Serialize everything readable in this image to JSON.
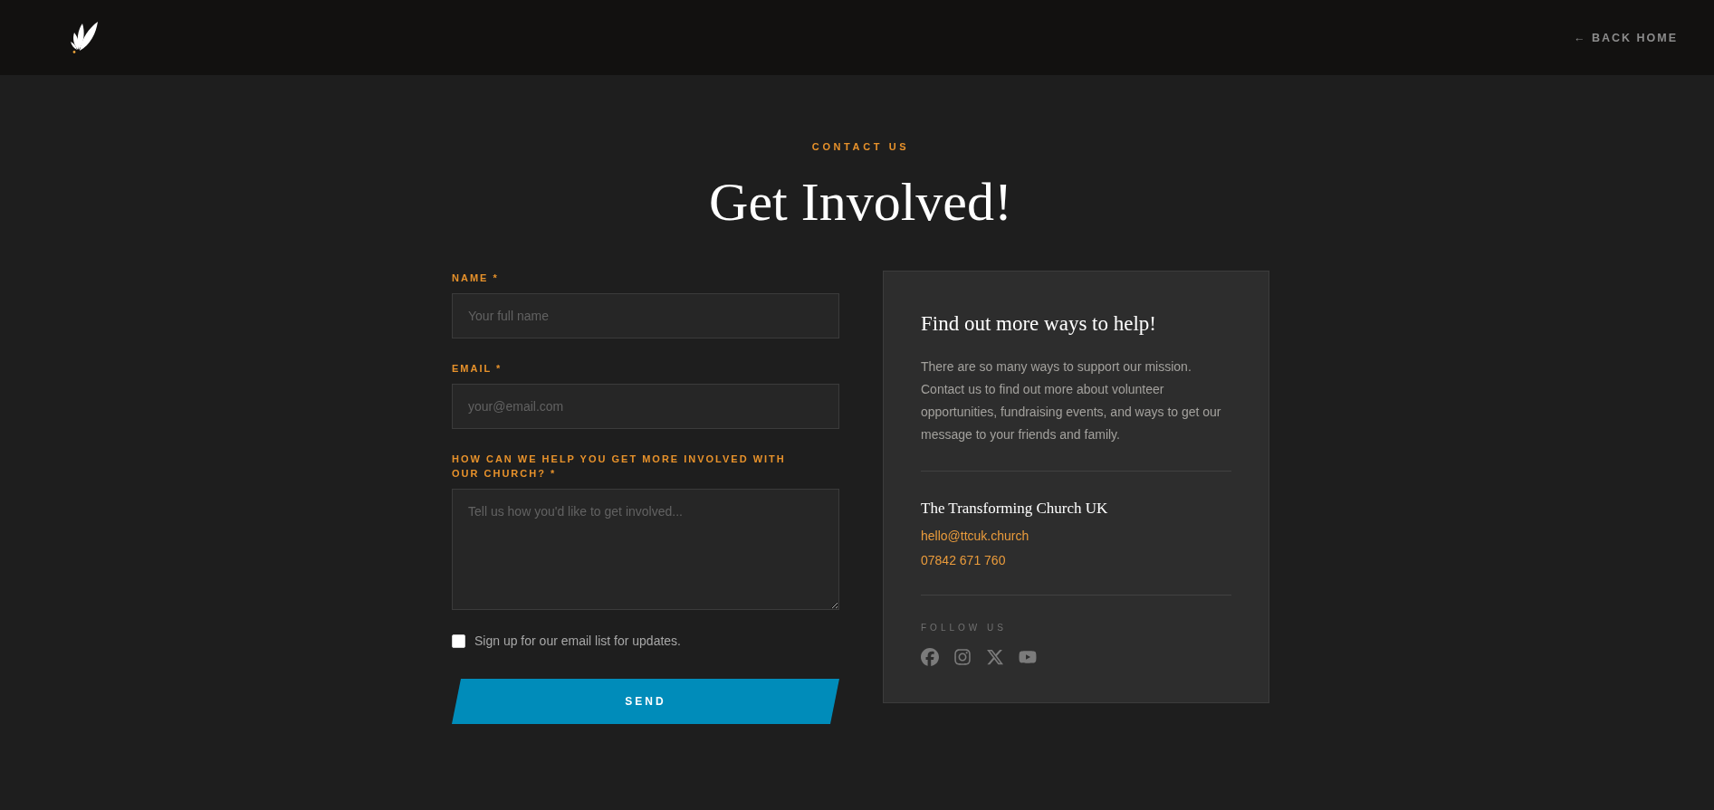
{
  "header": {
    "back_link": "← BACK HOME"
  },
  "hero": {
    "eyebrow": "CONTACT US",
    "title": "Get Involved!"
  },
  "form": {
    "fields": [
      {
        "kind": "input",
        "label": "NAME *",
        "placeholder": "Your full name"
      },
      {
        "kind": "input",
        "label": "EMAIL *",
        "placeholder": "your@email.com"
      },
      {
        "kind": "textarea",
        "label": "HOW CAN WE HELP YOU GET MORE INVOLVED WITH OUR CHURCH? *",
        "placeholder": "Tell us how you'd like to get involved..."
      }
    ],
    "newsletter": {
      "label": "Sign up for our email list for updates.",
      "checked": false
    },
    "submit": "SEND"
  },
  "info_panel": {
    "title": "Find out more ways to help!",
    "body": "There are so many ways to support our mission. Contact us to find out more about volunteer opportunities, fundraising events, and ways to get our message to your friends and family.",
    "organization": "The Transforming Church UK",
    "email": "hello@ttcuk.church",
    "phone": "07842 671 760",
    "follow_label": "FOLLOW US",
    "social_links": [
      {
        "kind": "facebook"
      },
      {
        "kind": "instagram"
      },
      {
        "kind": "x"
      },
      {
        "kind": "youtube"
      }
    ]
  }
}
